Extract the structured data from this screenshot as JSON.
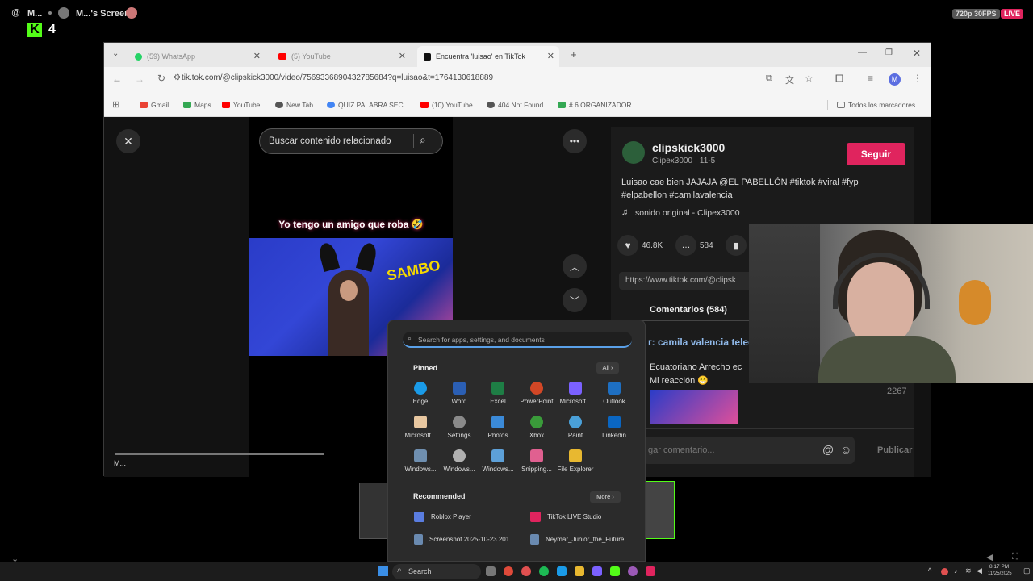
{
  "stream": {
    "user": "M...",
    "screen_label": "M...'s Screen",
    "viewers": "4",
    "quality": "720p 30FPS",
    "live": "LIVE"
  },
  "browser": {
    "tabs": [
      {
        "label": "(59) WhatsApp",
        "color": "#25D366"
      },
      {
        "label": "(5) YouTube",
        "color": "#FF0000"
      },
      {
        "label": "Encuentra 'luisao' en TikTok",
        "color": "#111111"
      }
    ],
    "url": "tik.tok.com/@clipskick3000/video/7569336890432785684?q=luisao&t=1764130618889",
    "profile_initial": "M",
    "bookmarks": [
      {
        "label": "Gmail",
        "color": "#EA4335"
      },
      {
        "label": "Maps",
        "color": "#34A853"
      },
      {
        "label": "YouTube",
        "color": "#FF0000"
      },
      {
        "label": "New Tab",
        "color": "#555555"
      },
      {
        "label": "QUIZ PALABRA SEC...",
        "color": "#4285F4"
      },
      {
        "label": "(10) YouTube",
        "color": "#FF0000"
      },
      {
        "label": "404 Not Found",
        "color": "#555555"
      },
      {
        "label": "# 6 ORGANIZADOR...",
        "color": "#34A853"
      }
    ],
    "all_bookmarks": "Todos los marcadores"
  },
  "tiktok": {
    "search_placeholder": "Buscar contenido relacionado",
    "caption_overlay": "Yo tengo un amigo que roba 🤣",
    "author": "clipskick3000",
    "author_sub": "Clipex3000 · 11-5",
    "follow": "Seguir",
    "description": "Luisao cae bien JAJAJA @EL PABELLÓN #tiktok #viral #fyp #elpabellon #camilavalencia",
    "sound": "sonido original - Clipex3000",
    "likes": "46.8K",
    "comments_count": "584",
    "share_url": "https://www.tiktok.com/@clipsk",
    "comments_tab": "Comentarios (584)",
    "comment_1": "r: camila valencia teleg",
    "comment_2_user": "Ecuatoriano Arrecho ec",
    "comment_2_text": "Mi reacción 😁",
    "comment_count_2": "2267",
    "add_comment": "gar comentario...",
    "publish": "Publicar",
    "mini_label": "M..."
  },
  "startmenu": {
    "search_placeholder": "Search for apps, settings, and documents",
    "pinned": "Pinned",
    "all": "All",
    "apps": [
      {
        "label": "Edge",
        "color": "#1a9be8"
      },
      {
        "label": "Word",
        "color": "#2b5fb4"
      },
      {
        "label": "Excel",
        "color": "#1e7e45"
      },
      {
        "label": "PowerPoint",
        "color": "#d24726"
      },
      {
        "label": "Microsoft...",
        "color": "#7b61ff"
      },
      {
        "label": "Outlook",
        "color": "#1e6fc2"
      },
      {
        "label": "Microsoft...",
        "color": "#e8c7a0"
      },
      {
        "label": "Settings",
        "color": "#8a8a8a"
      },
      {
        "label": "Photos",
        "color": "#3b8ad8"
      },
      {
        "label": "Xbox",
        "color": "#3a9b3a"
      },
      {
        "label": "Paint",
        "color": "#4aa0d8"
      },
      {
        "label": "Linkedin",
        "color": "#0a66c2"
      },
      {
        "label": "Windows...",
        "color": "#6f8fb0"
      },
      {
        "label": "Windows...",
        "color": "#b0b0b0"
      },
      {
        "label": "Windows...",
        "color": "#5da0d8"
      },
      {
        "label": "Snipping...",
        "color": "#e06090"
      },
      {
        "label": "File Explorer",
        "color": "#e8b830"
      }
    ],
    "recommended": "Recommended",
    "more": "More",
    "recs": [
      {
        "label": "Roblox Player",
        "color": "#5a7de0"
      },
      {
        "label": "TikTok LIVE Studio",
        "color": "#e0245e"
      },
      {
        "label": "Screenshot 2025-10-23 201...",
        "color": "#6a8ab0"
      },
      {
        "label": "Neymar_Junior_the_Future...",
        "color": "#6a8ab0"
      }
    ]
  },
  "taskbar": {
    "search": "Search",
    "time": "8:17 PM",
    "date": "11/25/2025"
  }
}
